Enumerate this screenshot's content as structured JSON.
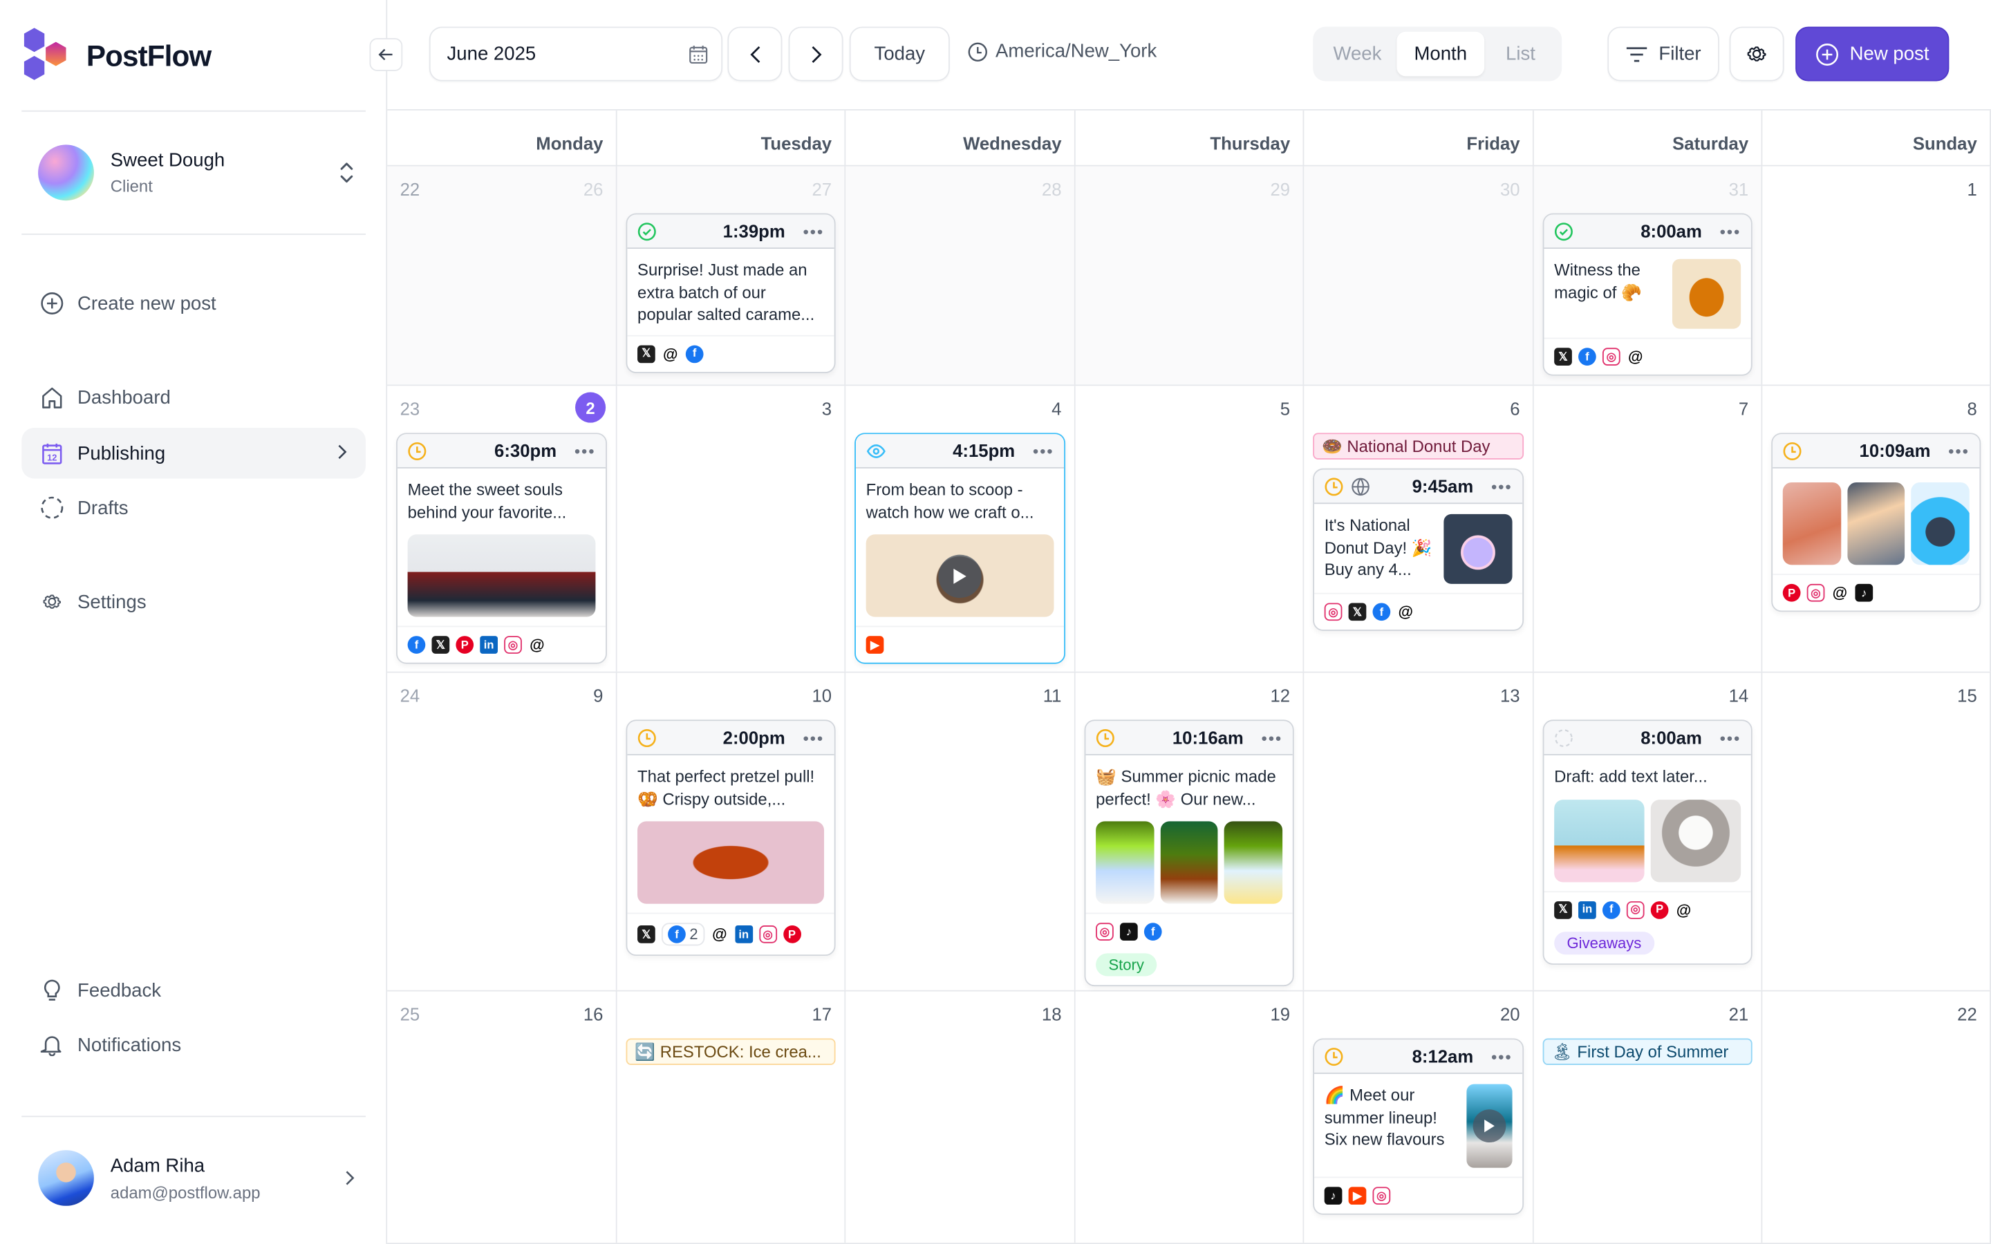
{
  "app": {
    "name": "PostFlow",
    "colors": {
      "brand_purple": "#6049d6",
      "today_badge": "#7c5cf0",
      "scheduled_amber": "#f59e0b",
      "published_green": "#22c55e",
      "review_blue": "#38bdf8"
    }
  },
  "sidebar": {
    "workspace": {
      "name": "Sweet Dough",
      "role": "Client",
      "icon": "chevron-up-down-icon"
    },
    "primary_action": {
      "label": "Create new post",
      "icon": "plus-circle-icon"
    },
    "nav": [
      {
        "label": "Dashboard",
        "icon": "home-icon",
        "active": false
      },
      {
        "label": "Publishing",
        "icon": "calendar-icon",
        "active": true
      },
      {
        "label": "Drafts",
        "icon": "dashed-circle-icon",
        "active": false
      },
      {
        "label": "Settings",
        "icon": "gear-icon",
        "active": false
      }
    ],
    "bottom_nav": [
      {
        "label": "Feedback",
        "icon": "lightbulb-icon"
      },
      {
        "label": "Notifications",
        "icon": "bell-icon"
      }
    ],
    "user": {
      "name": "Adam Riha",
      "email": "adam@postflow.app"
    }
  },
  "toolbar": {
    "month_value": "June 2025",
    "today_label": "Today",
    "timezone": "America/New_York",
    "views": [
      {
        "label": "Week",
        "active": false
      },
      {
        "label": "Month",
        "active": true
      },
      {
        "label": "List",
        "active": false
      }
    ],
    "filter_label": "Filter",
    "new_post_label": "New post"
  },
  "calendar": {
    "weekdays": [
      "Monday",
      "Tuesday",
      "Wednesday",
      "Thursday",
      "Friday",
      "Saturday",
      "Sunday"
    ],
    "weeks": [
      {
        "week_number": "22",
        "days": [
          {
            "date": "26",
            "other_month": true
          },
          {
            "date": "27",
            "other_month": true,
            "posts": [
              {
                "status": "published",
                "time": "1:39pm",
                "text": "Surprise! Just made an extra batch of our popular salted carame...",
                "networks": [
                  "x",
                  "threads",
                  "facebook"
                ]
              }
            ]
          },
          {
            "date": "28",
            "other_month": true
          },
          {
            "date": "29",
            "other_month": true
          },
          {
            "date": "30",
            "other_month": true
          },
          {
            "date": "31",
            "other_month": true,
            "posts": [
              {
                "status": "published",
                "time": "8:00am",
                "text": "Witness the magic of 🥐",
                "media": "croissant-thumbnail",
                "networks": [
                  "x",
                  "facebook",
                  "instagram",
                  "threads"
                ]
              }
            ]
          },
          {
            "date": "1"
          }
        ]
      },
      {
        "week_number": "23",
        "days": [
          {
            "date": "2",
            "today": true,
            "posts": [
              {
                "status": "scheduled",
                "time": "6:30pm",
                "text": "Meet the sweet souls behind your favorite...",
                "media": "bakers-photo",
                "networks": [
                  "facebook",
                  "x",
                  "pinterest",
                  "linkedin",
                  "instagram",
                  "threads"
                ]
              }
            ]
          },
          {
            "date": "3"
          },
          {
            "date": "4",
            "posts": [
              {
                "status": "in-review",
                "time": "4:15pm",
                "text": "From bean to scoop - watch how we craft o...",
                "media": "ice-cream-video",
                "networks": [
                  "youtube"
                ]
              }
            ]
          },
          {
            "date": "5"
          },
          {
            "date": "6",
            "events": [
              "🍩 National Donut Day"
            ],
            "posts": [
              {
                "status": "scheduled",
                "time": "9:45am",
                "extra_icon": "globe-icon",
                "text": "It's National Donut Day! 🎉 Buy any 4...",
                "media": "donut-thumbnail",
                "networks": [
                  "instagram",
                  "x",
                  "facebook",
                  "threads"
                ]
              }
            ]
          },
          {
            "date": "7"
          },
          {
            "date": "8",
            "posts": [
              {
                "status": "scheduled",
                "time": "10:09am",
                "text": "",
                "media": "macarons-gallery-3",
                "networks": [
                  "pinterest",
                  "instagram",
                  "threads",
                  "tiktok"
                ]
              }
            ]
          }
        ]
      },
      {
        "week_number": "24",
        "days": [
          {
            "date": "9"
          },
          {
            "date": "10",
            "posts": [
              {
                "status": "scheduled",
                "time": "2:00pm",
                "text": "That perfect pretzel pull! 🥨 Crispy outside,...",
                "media": "pretzel-photo",
                "networks": [
                  "x",
                  "facebook",
                  "threads",
                  "linkedin",
                  "instagram",
                  "pinterest"
                ],
                "facebook_count": "2"
              }
            ]
          },
          {
            "date": "11"
          },
          {
            "date": "12",
            "posts": [
              {
                "status": "scheduled",
                "time": "10:16am",
                "text": "🧺 Summer picnic made perfect! 🌸 Our new...",
                "media": "picnic-gallery-3",
                "networks": [
                  "instagram",
                  "tiktok",
                  "facebook"
                ],
                "tag": "Story"
              }
            ]
          },
          {
            "date": "13"
          },
          {
            "date": "14",
            "posts": [
              {
                "status": "draft",
                "time": "8:00am",
                "text": "Draft: add text later...",
                "media": "cupcakes-gallery-2",
                "networks": [
                  "x",
                  "linkedin",
                  "facebook",
                  "instagram",
                  "pinterest",
                  "threads"
                ],
                "tag": "Giveaways"
              }
            ]
          },
          {
            "date": "15"
          }
        ]
      },
      {
        "week_number": "25",
        "days": [
          {
            "date": "16"
          },
          {
            "date": "17",
            "events": [
              "🔄 RESTOCK: Ice crea..."
            ]
          },
          {
            "date": "18"
          },
          {
            "date": "19"
          },
          {
            "date": "20",
            "posts": [
              {
                "status": "scheduled",
                "time": "8:12am",
                "text": "🌈 Meet our summer lineup! Six new flavours",
                "media": "beach-video-thumbnail",
                "networks": [
                  "tiktok",
                  "youtube",
                  "instagram"
                ]
              }
            ]
          },
          {
            "date": "21",
            "events": [
              "🏝 First Day of Summer"
            ]
          },
          {
            "date": "22"
          }
        ]
      }
    ]
  }
}
